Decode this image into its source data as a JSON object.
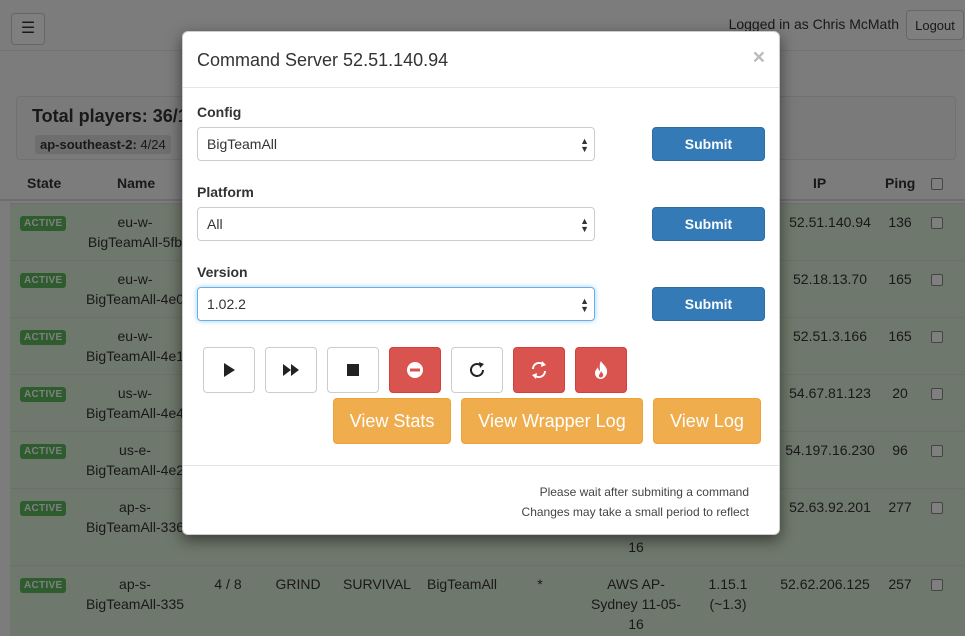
{
  "navbar": {
    "menu_icon": "hamburger-icon",
    "login_text": "Logged in as Chris McMath",
    "logout_label": "Logout"
  },
  "summary": {
    "total": "Total players: 36/1",
    "region_name": "ap-southeast-2:",
    "region_count": "4/24"
  },
  "table": {
    "headers": {
      "state": "State",
      "name": "Name",
      "ip": "IP",
      "ping": "Ping"
    },
    "rows": [
      {
        "state": "ACTIVE",
        "name1": "eu-w-",
        "name2": "BigTeamAll-5fb",
        "ip": "52.51.140.94",
        "ping": "136"
      },
      {
        "state": "ACTIVE",
        "name1": "eu-w-",
        "name2": "BigTeamAll-4e0",
        "ip": "52.18.13.70",
        "ping": "165"
      },
      {
        "state": "ACTIVE",
        "name1": "eu-w-",
        "name2": "BigTeamAll-4e1",
        "ip": "52.51.3.166",
        "ping": "165"
      },
      {
        "state": "ACTIVE",
        "name1": "us-w-",
        "name2": "BigTeamAll-4e4",
        "ip": "54.67.81.123",
        "ping": "20"
      },
      {
        "state": "ACTIVE",
        "name1": "us-e-",
        "name2": "BigTeamAll-4e2",
        "ip": "54.197.16.230",
        "ping": "96"
      },
      {
        "state": "ACTIVE",
        "name1": "ap-s-",
        "name2": "BigTeamAll-336",
        "extra": "16",
        "ip": "52.63.92.201",
        "ping": "277"
      },
      {
        "state": "ACTIVE",
        "name1": "ap-s-",
        "name2": "BigTeamAll-335",
        "players": "4 / 8",
        "mode": "GRIND",
        "type": "SURVIVAL",
        "config": "BigTeamAll",
        "star": "*",
        "loc1": "AWS AP-",
        "loc2": "Sydney 11-05-",
        "loc3": "16",
        "ver1": "1.15.1",
        "ver2": "(~1.3)",
        "ip": "52.62.206.125",
        "ping": "257"
      }
    ]
  },
  "modal": {
    "title": "Command Server 52.51.140.94",
    "close": "×",
    "config_label": "Config",
    "config_value": "BigTeamAll",
    "platform_label": "Platform",
    "platform_value": "All",
    "version_label": "Version",
    "version_value": "1.02.2",
    "submit_label": "Submit",
    "controls": [
      "play-icon",
      "fast-forward-icon",
      "stop-icon",
      "minus-circle-icon",
      "refresh-icon",
      "sync-icon",
      "fire-icon"
    ],
    "view_stats": "View Stats",
    "view_wrapper_log": "View Wrapper Log",
    "view_log": "View Log",
    "note1": "Please wait after submiting a command",
    "note2": "Changes may take a small period to reflect"
  },
  "colors": {
    "primary": "#337ab7",
    "danger": "#d9534f",
    "warning": "#f0ad4e",
    "success": "#5cb85c",
    "row_bg": "#dff0d8"
  }
}
